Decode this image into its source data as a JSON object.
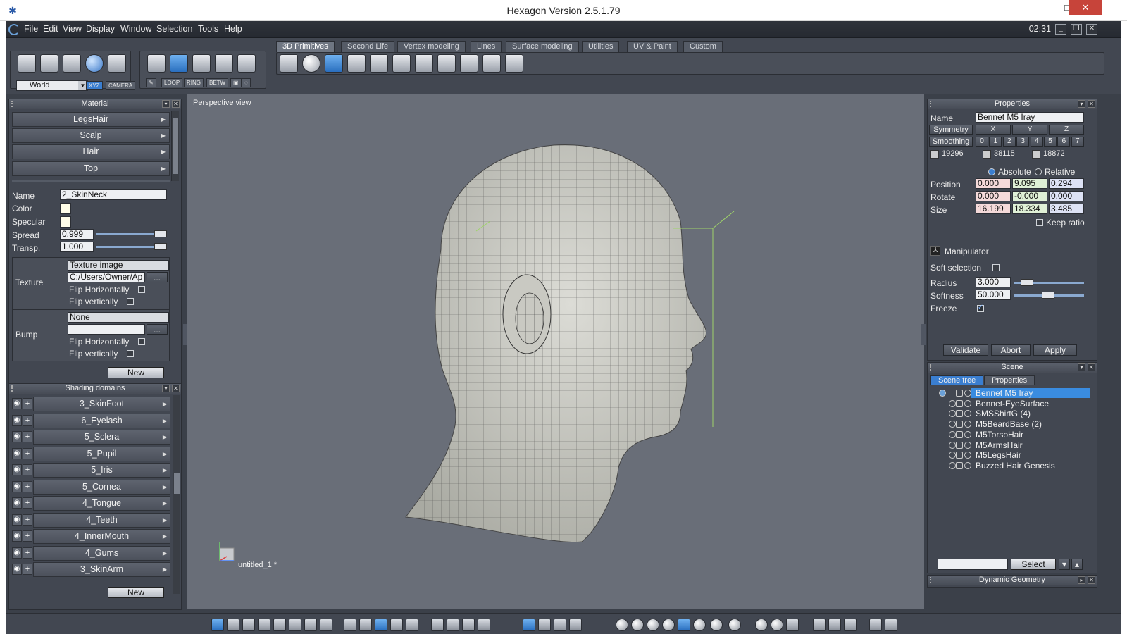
{
  "window": {
    "title": "Hexagon Version 2.5.1.79",
    "controls": [
      "—",
      "□",
      "✕"
    ]
  },
  "menu": {
    "items": [
      "File",
      "Edit",
      "View",
      "Display",
      "Window",
      "Selection",
      "Tools",
      "Help"
    ],
    "clock": "02:31"
  },
  "toolbar": {
    "coord_space": "World",
    "xyz_label": "XYZ",
    "camera_label": "CAMERA",
    "select_modes": [
      "LOOP",
      "RING",
      "BETW"
    ]
  },
  "tabs": [
    "3D Primitives",
    "Second Life",
    "Vertex modeling",
    "Lines",
    "Surface modeling",
    "Utilities",
    "UV & Paint",
    "Custom"
  ],
  "material_panel": {
    "title": "Material",
    "items": [
      "LegsHair",
      "Scalp",
      "Hair",
      "Top"
    ],
    "name_label": "Name",
    "name_value": "2_SkinNeck",
    "color_label": "Color",
    "specular_label": "Specular",
    "spread_label": "Spread",
    "spread_value": "0.999",
    "transp_label": "Transp.",
    "transp_value": "1.000",
    "texture_label": "Texture",
    "texture_type": "Texture image",
    "texture_path": "C:/Users/Owner/Ap",
    "browse": "...",
    "flip_h": "Flip Horizontally",
    "flip_v": "Flip vertically",
    "bump_label": "Bump",
    "bump_type": "None",
    "new_button": "New"
  },
  "shading_panel": {
    "title": "Shading domains",
    "items": [
      "3_SkinFoot",
      "6_Eyelash",
      "5_Sclera",
      "5_Pupil",
      "5_Iris",
      "5_Cornea",
      "4_Tongue",
      "4_Teeth",
      "4_InnerMouth",
      "4_Gums",
      "3_SkinArm"
    ],
    "new_button": "New"
  },
  "viewport": {
    "title": "Perspective view",
    "file": "untitled_1 *"
  },
  "properties_panel": {
    "title": "Properties",
    "name_label": "Name",
    "name_value": "Bennet M5 Iray",
    "symmetry_label": "Symmetry",
    "symmetry_axes": [
      "X",
      "Y",
      "Z"
    ],
    "smoothing_label": "Smoothing",
    "smoothing_levels": [
      "0",
      "1",
      "2",
      "3",
      "4",
      "5",
      "6",
      "7"
    ],
    "counts": [
      "19296",
      "38115",
      "18872"
    ],
    "absolute": "Absolute",
    "relative": "Relative",
    "position_label": "Position",
    "position": [
      "0.000",
      "9.095",
      "0.294"
    ],
    "rotate_label": "Rotate",
    "rotate": [
      "0.000",
      "-0.000",
      "0.000"
    ],
    "size_label": "Size",
    "size": [
      "16.199",
      "18.334",
      "3.485"
    ],
    "keep_ratio": "Keep ratio",
    "manipulator": "Manipulator",
    "soft_selection": "Soft selection",
    "radius_label": "Radius",
    "radius_value": "3.000",
    "softness_label": "Softness",
    "softness_value": "50.000",
    "freeze_label": "Freeze",
    "validate": "Validate",
    "abort": "Abort",
    "apply": "Apply"
  },
  "scene_panel": {
    "title": "Scene",
    "tab_tree": "Scene tree",
    "tab_props": "Properties",
    "items": [
      "Bennet M5 Iray",
      "Bennet-EyeSurface",
      "SMSShirtG (4)",
      "M5BeardBase (2)",
      "M5TorsoHair",
      "M5ArmsHair",
      "M5LegsHair",
      "Buzzed Hair Genesis"
    ],
    "select_button": "Select"
  },
  "dynamic_geometry_panel": {
    "title": "Dynamic Geometry"
  },
  "colors": {
    "viewport_bg": "#696e78",
    "panel_bg": "#424751",
    "selection": "#3a8ce0"
  }
}
